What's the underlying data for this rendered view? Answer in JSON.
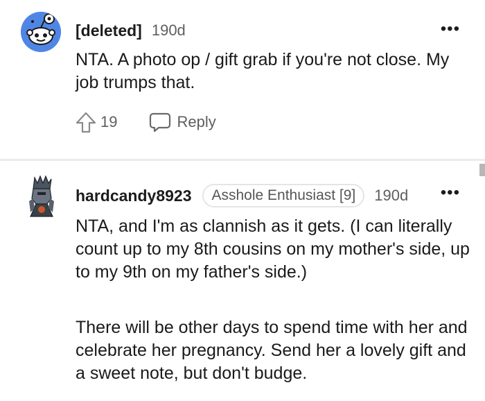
{
  "comments": [
    {
      "author": "[deleted]",
      "age": "190d",
      "more": "•••",
      "avatar_icon": "snoo-avatar-icon",
      "body": "NTA. A photo op / gift grab if you're not close. My job trumps that.",
      "upvote_count": "19",
      "reply_label": "Reply"
    },
    {
      "author": "hardcandy8923",
      "flair": "Asshole Enthusiast [9]",
      "age": "190d",
      "more": "•••",
      "avatar_icon": "knight-avatar-icon",
      "paragraphs": [
        "NTA, and I'm as clannish as it gets. (I can literally count up to my 8th cousins on my mother's side, up to my 9th on my father's side.)",
        "There will be other days to spend time with her and celebrate her pregnancy. Send her a lovely gift and a sweet note, but don't budge."
      ]
    }
  ],
  "colors": {
    "avatar_blue": "#4f86e6",
    "meta_gray": "#5e5e5e",
    "divider": "#ececec"
  }
}
